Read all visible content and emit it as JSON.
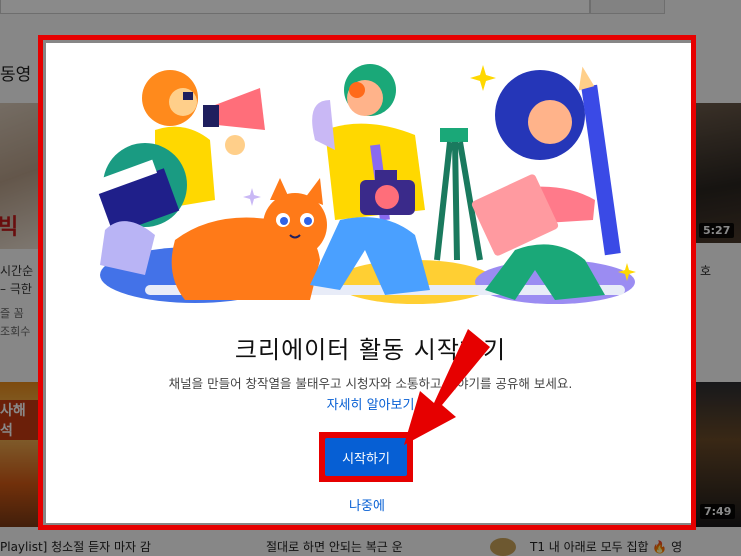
{
  "background": {
    "section_title": "동영",
    "left_top_thumb_text": "빅",
    "right_top_duration": "5:27",
    "left_video_title": "시간순",
    "left_video_title2": "– 극한",
    "left_channel": "즐 꼼",
    "left_views": "조회수",
    "right_video_title": "호",
    "left_mid_thumb_text": "사해석",
    "right_mid_duration": "7:49",
    "bottom_left_title": "Playlist] 청소절 듣자 마자 감",
    "bottom_mid_title": "절대로 하면 안되는 복근 운",
    "bottom_right_title": "T1 내 아래로 모두 집합 🔥 영"
  },
  "dialog": {
    "title": "크리에이터 활동 시작하기",
    "subtitle": "채널을 만들어 창작열을 불태우고 시청자와 소통하고 이야기를 공유해 보세요.",
    "learn_more": "자세히 알아보기",
    "start_button": "시작하기",
    "later_button": "나중에"
  },
  "colors": {
    "accent_blue": "#065fd4",
    "annotation_red": "#e60000"
  }
}
